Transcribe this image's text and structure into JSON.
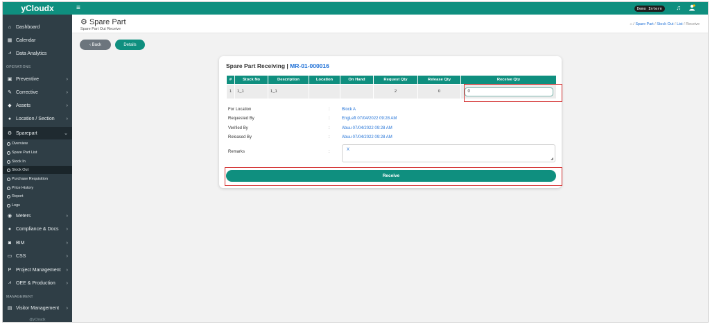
{
  "sidebar": {
    "brand": "yCloudx",
    "items": [
      {
        "label": "Dashboard",
        "icon": "home-icon",
        "chev": false
      },
      {
        "label": "Calendar",
        "icon": "calendar-icon",
        "chev": false
      },
      {
        "label": "Data Analytics",
        "icon": "chart-icon",
        "chev": false
      },
      {
        "label": "Preventive",
        "icon": "calendar-check-icon",
        "chev": true
      },
      {
        "label": "Corrective",
        "icon": "wrench-icon",
        "chev": true
      },
      {
        "label": "Assets",
        "icon": "tag-icon",
        "chev": true
      },
      {
        "label": "Location / Section",
        "icon": "location-icon",
        "chev": true
      },
      {
        "label": "Sparepart",
        "icon": "cogs-icon",
        "chev": true
      },
      {
        "label": "Meters",
        "icon": "gauge-icon",
        "chev": true
      },
      {
        "label": "Compliance & Docs",
        "icon": "circle-icon",
        "chev": true
      },
      {
        "label": "BIM",
        "icon": "bim-icon",
        "chev": true
      },
      {
        "label": "CSS",
        "icon": "monitor-icon",
        "chev": true
      },
      {
        "label": "Project Management",
        "icon": "project-icon",
        "chev": true
      },
      {
        "label": "OEE & Production",
        "icon": "line-chart-icon",
        "chev": true
      },
      {
        "label": "Visitor Management",
        "icon": "id-card-icon",
        "chev": true
      }
    ],
    "section_operations": "OPERATIONS",
    "section_management": "MANAGEMENT",
    "sparepart_sub": [
      "Overview",
      "Spare Part List",
      "Stock In",
      "Stock Out",
      "Purchase Requisition",
      "Price History",
      "Report",
      "Logs"
    ],
    "footer": "@yCloudx"
  },
  "topbar": {
    "user": "Demo Intern"
  },
  "page": {
    "title": "Spare Part",
    "subtitle": "Spare Part Out Receive",
    "breadcrumbs": [
      "Spare Part",
      "Stock Out",
      "List",
      "Receive"
    ],
    "back_label": "Back",
    "details_label": "Details"
  },
  "card": {
    "title": "Spare Part Receiving |",
    "code": "MR-01-000016",
    "columns": [
      "#",
      "Stock No",
      "Description",
      "Location",
      "On Hand",
      "Request Qty",
      "Release Qty",
      "Receive Qty"
    ],
    "row": {
      "no": "1",
      "stock_no": "1_1",
      "description": "1_1",
      "location": "",
      "on_hand": "",
      "request_qty": "2",
      "release_qty": "0",
      "receive_qty": "0"
    },
    "info": [
      {
        "label": "For Location",
        "value": "Block A"
      },
      {
        "label": "Requested By",
        "value": "EngLeft 07/04/2022 09:28 AM"
      },
      {
        "label": "Verified By",
        "value": "Abuu 07/04/2022 09:28 AM"
      },
      {
        "label": "Released By",
        "value": "Abuu 07/04/2022 09:28 AM"
      }
    ],
    "remarks_label": "Remarks",
    "remarks_value": "X",
    "receive_label": "Receive"
  },
  "colors": {
    "accent": "#0f8f7f",
    "sidebar": "#2f3e46",
    "link": "#1d6fd6",
    "highlight": "#d32f2f"
  }
}
